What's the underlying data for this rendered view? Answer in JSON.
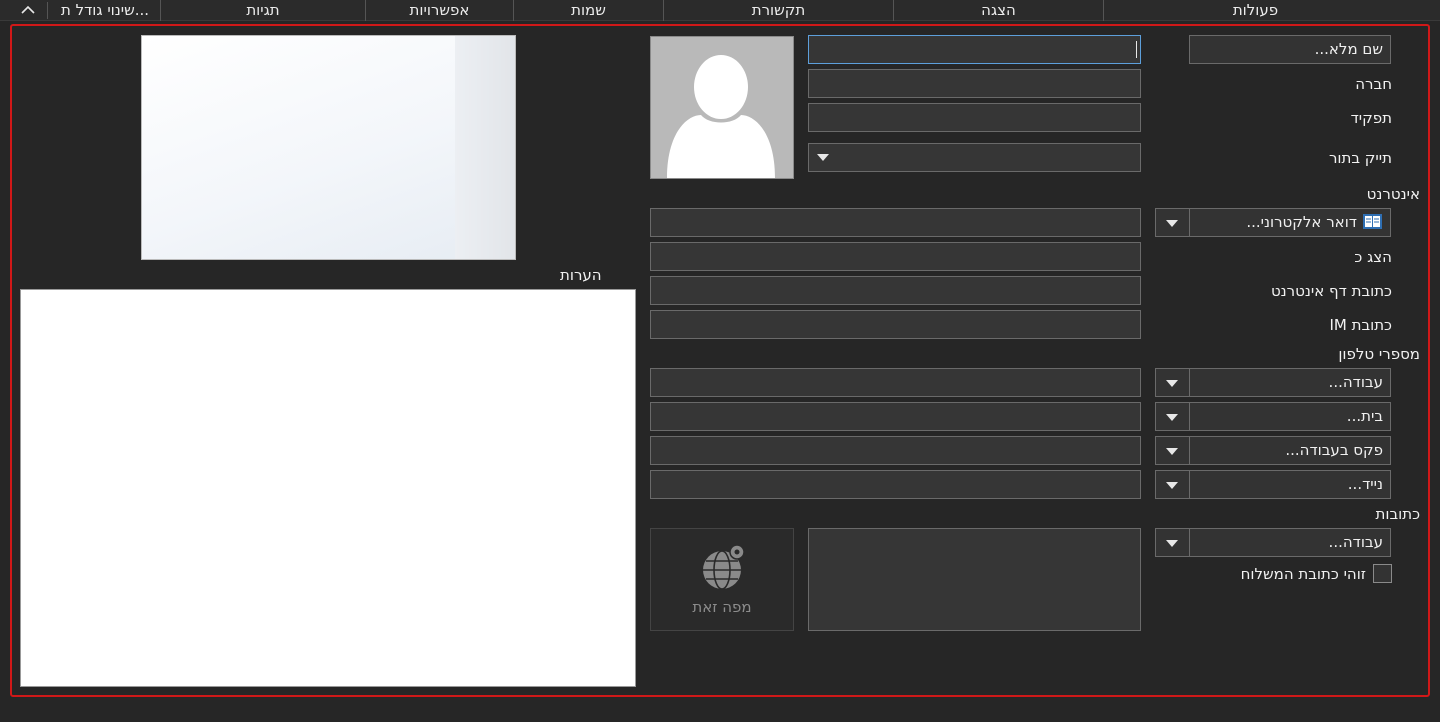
{
  "ribbon": {
    "collapse_icon": "chevron-up-icon",
    "tabs": [
      {
        "label": "פעולות"
      },
      {
        "label": "הצגה"
      },
      {
        "label": "תקשורת"
      },
      {
        "label": "שמות"
      },
      {
        "label": "אפשרויות"
      },
      {
        "label": "תגיות"
      },
      {
        "label": "שינוי גודל ת..."
      }
    ]
  },
  "name_section": {
    "full_name_button": "שם מלא...",
    "full_name_value": "",
    "company_label": "חברה",
    "job_title_label": "תפקיד",
    "file_as_label": "תייק בתור",
    "photo_icon": "contact-silhouette-icon"
  },
  "internet": {
    "section_label": "אינטרנט",
    "email_button": "דואר אלקטרוני...",
    "email_icon": "address-book-icon",
    "display_as_label": "הצג כ",
    "web_page_label": "כתובת דף אינטרנט",
    "im_label": "כתובת IM"
  },
  "phones": {
    "section_label": "מספרי טלפון",
    "items": [
      {
        "label": "עבודה..."
      },
      {
        "label": "בית..."
      },
      {
        "label": "פקס בעבודה..."
      },
      {
        "label": "נייד..."
      }
    ]
  },
  "addresses": {
    "section_label": "כתובות",
    "address_button": "עבודה...",
    "mailing_checkbox_label": "זוהי כתובת המשלוח",
    "map_label": "מפה זאת",
    "map_icon": "globe-pin-icon"
  },
  "notes": {
    "label": "הערות"
  }
}
